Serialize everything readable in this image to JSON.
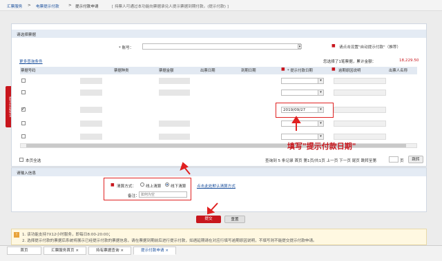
{
  "breadcrumb": {
    "home": "汇票服务",
    "sep1": ">",
    "l1": "电票提示付款",
    "sep2": ">",
    "l2": "提示付款申请",
    "note": "[ 持票人可通过本功能向票据承兑人提示票据到期付款。(提示付款) ]"
  },
  "side_tab": "提示付款申请",
  "panel": {
    "title": "请选择票据",
    "acct_label": "* 账号：",
    "auto_link": "请点击设置\"自动提示付款\"（推荐）",
    "more_link": "更多查询条件",
    "summary": "您选择了1笔票据，累计金额：",
    "summary_amt": "18,229.50"
  },
  "columns": [
    "票据号码",
    "票据种类",
    "票据金额",
    "出票日期",
    "到期日期",
    "* 提示付款日期",
    "逾期原因说明",
    "出票人名称"
  ],
  "rows": [
    {
      "no": "1102302027492019030635741",
      "type": "银承",
      "amt": "",
      "issue": "2019/03/12",
      "due": "2019/09/12",
      "pay_date": "",
      "payer": "江阴市红柳被单厂有限公司",
      "checked": false
    },
    {
      "no": "1313305060066201903183823",
      "type": "银承",
      "amt": "",
      "issue": "2019/03/18",
      "due": "2019/09/18",
      "pay_date": "",
      "payer": "莱克电气股份有限公司",
      "checked": false
    },
    {
      "no": "1302603044600201904033178",
      "type": "银承",
      "amt": "18,229.50",
      "issue": "2019/04/03",
      "due": "2019/09/27",
      "pay_date": "2019/09/27",
      "payer": "广东乐心医疗电子股份有限公司",
      "checked": true
    },
    {
      "no": "1313227600251201904023712",
      "type": "银承",
      "amt": "",
      "issue": "2019/04/02",
      "due": "2019/10/02",
      "pay_date": "",
      "payer": "温州佩奥实业有限公司",
      "checked": false
    },
    {
      "no": "1313240720292019040333318",
      "type": "银承",
      "amt": "",
      "issue": "2019/04/03",
      "due": "2019/10/03",
      "pay_date": "",
      "payer": "九江恒通自动控制器有限公司",
      "checked": false
    }
  ],
  "pager": {
    "select_all": "本页全选",
    "info": "查询到 5 条记录  首页 第1页/共1页  上一页  下一页  尾页  跳转至第",
    "page_suffix": "页",
    "go": "跳转"
  },
  "input_panel": {
    "title": "请输入信息",
    "settle_label": "清算方式：",
    "opt_online": "线上清算",
    "opt_offline": "线下清算",
    "default_link": "点击此处默认清算方式",
    "remark_label": "备注：",
    "remark_placeholder": "如何为空"
  },
  "annotation": "填写\"提示付款日期\"",
  "buttons": {
    "submit": "提交",
    "reset": "重置"
  },
  "notice": {
    "l1": "1. 该功能支持7X12小时服务，即每日8:00-20:00；",
    "l2": "2. 选择提示付款的票据后系统将展示已经提示付款的票据信息，请在票据到期前后进行提示付款，如遇延期请在对应行填写逾期原因说明，不填写则不能提交提示付款申请。"
  },
  "tabs": [
    "首页",
    "汇票服务首页",
    "持有票据查询",
    "提示付款申请"
  ]
}
